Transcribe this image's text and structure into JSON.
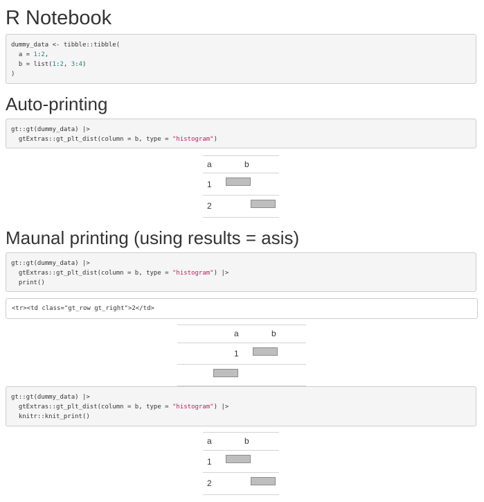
{
  "page": {
    "title": "R Notebook"
  },
  "chunk_setup": {
    "lines": [
      [
        {
          "t": "dummy_data <- tibble::tibble("
        }
      ],
      [
        {
          "t": "  a = "
        },
        {
          "t": "1",
          "c": "num"
        },
        {
          "t": ":"
        },
        {
          "t": "2",
          "c": "num"
        },
        {
          "t": ","
        }
      ],
      [
        {
          "t": "  b = list("
        },
        {
          "t": "1",
          "c": "num"
        },
        {
          "t": ":"
        },
        {
          "t": "2",
          "c": "num"
        },
        {
          "t": ", "
        },
        {
          "t": "3",
          "c": "num"
        },
        {
          "t": ":"
        },
        {
          "t": "4",
          "c": "num"
        },
        {
          "t": ")"
        }
      ],
      [
        {
          "t": ")"
        }
      ]
    ]
  },
  "section_auto": {
    "heading": "Auto-printing"
  },
  "chunk_auto": {
    "lines": [
      [
        {
          "t": "gt::gt(dummy_data) |>"
        }
      ],
      [
        {
          "t": "  gtExtras::gt_plt_dist(column = b, type = "
        },
        {
          "t": "\"histogram\"",
          "c": "str"
        },
        {
          "t": ")"
        }
      ]
    ]
  },
  "table_auto": {
    "columns": [
      "a",
      "b"
    ],
    "rows": [
      {
        "a": "1",
        "hist_bin": 0
      },
      {
        "a": "2",
        "hist_bin": 1
      }
    ]
  },
  "section_manual": {
    "heading": "Maunal printing (using results = asis)"
  },
  "chunk_manual_print": {
    "lines": [
      [
        {
          "t": "gt::gt(dummy_data) |>"
        }
      ],
      [
        {
          "t": "  gtExtras::gt_plt_dist(column = b, type = "
        },
        {
          "t": "\"histogram\"",
          "c": "str"
        },
        {
          "t": ") |>"
        }
      ],
      [
        {
          "t": "  print()"
        }
      ]
    ]
  },
  "raw_output": {
    "text": "<tr><td class=\"gt_row gt_right\">2</td>"
  },
  "table_manual": {
    "columns": [
      "a",
      "b"
    ],
    "rows": [
      {
        "a": "1",
        "hist_bin": 0
      }
    ]
  },
  "chunk_knit_print": {
    "lines": [
      [
        {
          "t": "gt::gt(dummy_data) |>"
        }
      ],
      [
        {
          "t": "  gtExtras::gt_plt_dist(column = b, type = "
        },
        {
          "t": "\"histogram\"",
          "c": "str"
        },
        {
          "t": ") |>"
        }
      ],
      [
        {
          "t": "  knitr::knit_print()"
        }
      ]
    ]
  },
  "table_knit": {
    "columns": [
      "a",
      "b"
    ],
    "rows": [
      {
        "a": "1",
        "hist_bin": 0
      },
      {
        "a": "2",
        "hist_bin": 1
      }
    ]
  },
  "colors": {
    "code_bg": "#f5f5f5",
    "number": "#0e8a8a",
    "string": "#c41a5a",
    "bar_fill": "#bebebe"
  }
}
